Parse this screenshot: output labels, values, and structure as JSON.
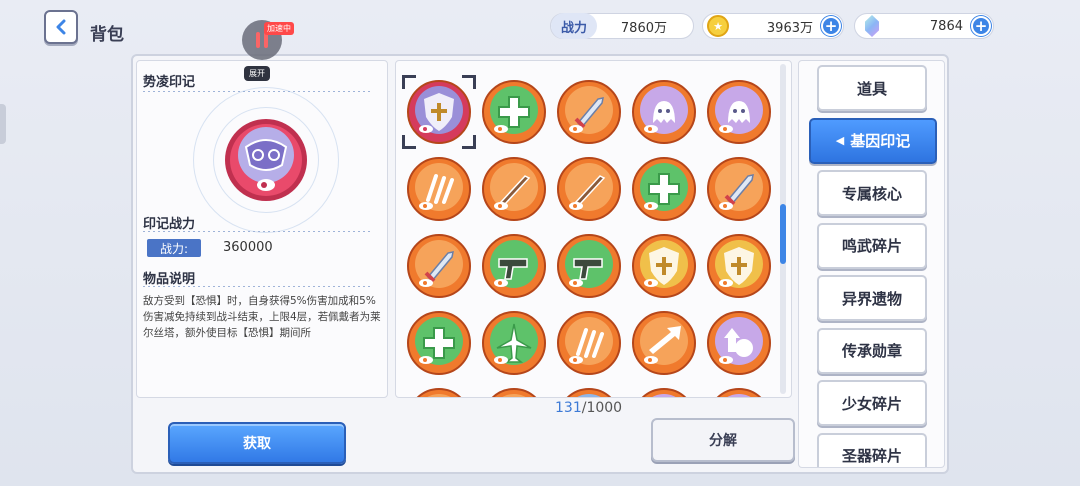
{
  "header": {
    "title": "背包",
    "pause_speed_tag": "加速中",
    "expand_tag": "展开"
  },
  "currencies": {
    "power_label": "战力",
    "power_value": "7860万",
    "coin_value": "3963万",
    "gem_value": "7864"
  },
  "detail": {
    "item_name": "势凌印记",
    "power_section": "印记战力",
    "power_label": "战力:",
    "power_value": "360000",
    "desc_section": "物品说明",
    "description": "敌方受到【恐惧】时，自身获得5%伤害加成和5%伤害减免持续到战斗结束，上限4层，若佩戴者为莱尔丝塔，额外使目标【恐惧】期间所"
  },
  "grid": {
    "count_current": "131",
    "count_total": "/1000",
    "items": [
      {
        "name": "shield-emblem-purple",
        "base": "#d53b5c",
        "inner": "#9a8fd8",
        "icon": "shield"
      },
      {
        "name": "cross-shield-orange",
        "base": "#f07a2d",
        "inner": "#5ec26a",
        "icon": "cross"
      },
      {
        "name": "sword-orange",
        "base": "#f07a2d",
        "inner": "#f6a35a",
        "icon": "sword"
      },
      {
        "name": "ghost-orange",
        "base": "#f07a2d",
        "inner": "#c7a8e8",
        "icon": "ghost"
      },
      {
        "name": "ghost-orange-2",
        "base": "#f07a2d",
        "inner": "#c7a8e8",
        "icon": "ghost"
      },
      {
        "name": "claw-orange",
        "base": "#f07a2d",
        "inner": "#f6a35a",
        "icon": "claw"
      },
      {
        "name": "blade-orange",
        "base": "#f07a2d",
        "inner": "#f6a35a",
        "icon": "blade"
      },
      {
        "name": "blade-orange-2",
        "base": "#f07a2d",
        "inner": "#f6a35a",
        "icon": "blade"
      },
      {
        "name": "cross-green",
        "base": "#f07a2d",
        "inner": "#5ec26a",
        "icon": "cross"
      },
      {
        "name": "sword-burst",
        "base": "#f07a2d",
        "inner": "#f6a35a",
        "icon": "sword"
      },
      {
        "name": "sword-burst-2",
        "base": "#f07a2d",
        "inner": "#f6a35a",
        "icon": "sword"
      },
      {
        "name": "gun-green",
        "base": "#f07a2d",
        "inner": "#5ec26a",
        "icon": "gun"
      },
      {
        "name": "gun-green-2",
        "base": "#f07a2d",
        "inner": "#5ec26a",
        "icon": "gun"
      },
      {
        "name": "shield-gold",
        "base": "#f07a2d",
        "inner": "#f0c04a",
        "icon": "shield"
      },
      {
        "name": "shield-gold-2",
        "base": "#f07a2d",
        "inner": "#f0c04a",
        "icon": "shield"
      },
      {
        "name": "leaf-cross-green",
        "base": "#f07a2d",
        "inner": "#5ec26a",
        "icon": "cross"
      },
      {
        "name": "plane-green",
        "base": "#f07a2d",
        "inner": "#5ec26a",
        "icon": "plane"
      },
      {
        "name": "scroll-orange",
        "base": "#f07a2d",
        "inner": "#f6a35a",
        "icon": "claw"
      },
      {
        "name": "arrow-orange",
        "base": "#f07a2d",
        "inner": "#f6a35a",
        "icon": "arrow"
      },
      {
        "name": "potion-purple",
        "base": "#f07a2d",
        "inner": "#c7a8e8",
        "icon": "potion"
      },
      {
        "name": "partial-1",
        "base": "#f07a2d",
        "inner": "#f6a35a",
        "icon": "none"
      },
      {
        "name": "partial-2",
        "base": "#f07a2d",
        "inner": "#f6a35a",
        "icon": "none"
      },
      {
        "name": "partial-3",
        "base": "#f07a2d",
        "inner": "#8fb6e8",
        "icon": "none"
      },
      {
        "name": "partial-4",
        "base": "#f07a2d",
        "inner": "#c7a8e8",
        "icon": "none"
      },
      {
        "name": "partial-5",
        "base": "#f07a2d",
        "inner": "#c7a8e8",
        "icon": "none"
      }
    ]
  },
  "actions": {
    "get_label": "获取",
    "decompose_label": "分解"
  },
  "tabs": [
    {
      "label": "道具",
      "active": false
    },
    {
      "label": "基因印记",
      "active": true
    },
    {
      "label": "专属核心",
      "active": false
    },
    {
      "label": "鸣武碎片",
      "active": false
    },
    {
      "label": "异界遗物",
      "active": false
    },
    {
      "label": "传承勋章",
      "active": false
    },
    {
      "label": "少女碎片",
      "active": false
    },
    {
      "label": "圣器碎片",
      "active": false
    }
  ],
  "colors": {
    "accent_blue": "#3d85e6",
    "emblem_orange": "#f07a2d",
    "emblem_red": "#d53b5c"
  }
}
